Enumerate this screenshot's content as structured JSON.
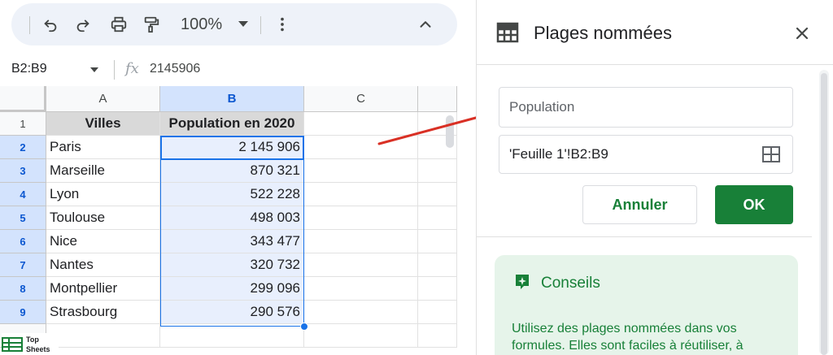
{
  "toolbar": {
    "undo_icon": "undo-icon",
    "redo_icon": "redo-icon",
    "print_icon": "print-icon",
    "paint_format_icon": "paint-format-icon",
    "zoom": "100%",
    "more_icon": "more-vert-icon",
    "collapse_icon": "chevron-up-icon"
  },
  "formula_bar": {
    "name_box": "B2:B9",
    "fx_label": "fx",
    "value": "2145906"
  },
  "grid": {
    "columns": [
      "A",
      "B",
      "C"
    ],
    "rows": [
      "1",
      "2",
      "3",
      "4",
      "5",
      "6",
      "7",
      "8",
      "9"
    ],
    "header": {
      "villes": "Villes",
      "population": "Population en 2020"
    },
    "data": [
      {
        "city": "Paris",
        "population": "2 145 906"
      },
      {
        "city": "Marseille",
        "population": "870 321"
      },
      {
        "city": "Lyon",
        "population": "522 228"
      },
      {
        "city": "Toulouse",
        "population": "498 003"
      },
      {
        "city": "Nice",
        "population": "343 477"
      },
      {
        "city": "Nantes",
        "population": "320 732"
      },
      {
        "city": "Montpellier",
        "population": "299 096"
      },
      {
        "city": "Strasbourg",
        "population": "290 576"
      }
    ],
    "selected_column": "B",
    "selected_rows": [
      "2",
      "3",
      "4",
      "5",
      "6",
      "7",
      "8",
      "9"
    ]
  },
  "logo": {
    "line1": "Top",
    "line2": "Sheets"
  },
  "panel": {
    "title": "Plages nommées",
    "icon": "table-icon",
    "close_icon": "close-icon",
    "name_value": "Population",
    "range_value": "'Feuille 1'!B2:B9",
    "range_icon": "grid-select-icon",
    "cancel_label": "Annuler",
    "ok_label": "OK",
    "tips_title": "Conseils",
    "tips_text": "Utilisez des plages nommées dans vos formules. Elles sont faciles à réutiliser, à"
  },
  "colors": {
    "accent_green": "#188038",
    "selection_blue": "#1a73e8",
    "arrow_red": "#d93025"
  }
}
